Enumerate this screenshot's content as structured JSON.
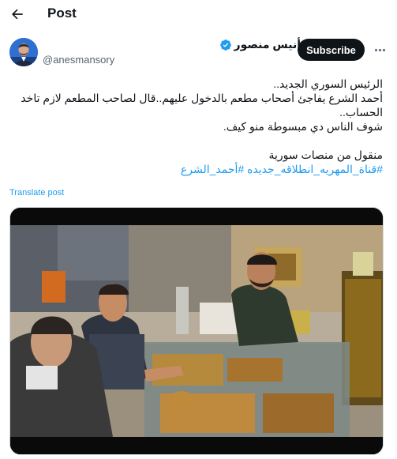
{
  "header": {
    "back_icon": "arrow-left-icon",
    "title": "Post"
  },
  "author": {
    "display_name": "أنيس منصور",
    "handle": "@anesmansory",
    "verified": true,
    "verified_color": "#1d9bf0"
  },
  "subscribe_label": "Subscribe",
  "tweet": {
    "lines": [
      "الرئيس السوري الجديد..",
      "أحمد الشرع يفاجئ أصحاب مطعم بالدخول عليهم..قال لصاحب المطعم لازم تاخد الحساب..",
      "شوف الناس دي مبسوطة منو كيف.",
      "منقول من منصات سورية"
    ],
    "hashtags": "#قناة_المهريه_انطلاقه_جديده #أحمد_الشرع"
  },
  "translate_label": "Translate post",
  "colors": {
    "link": "#1d9bf0",
    "button_bg": "#0f1419",
    "muted": "#536471"
  }
}
